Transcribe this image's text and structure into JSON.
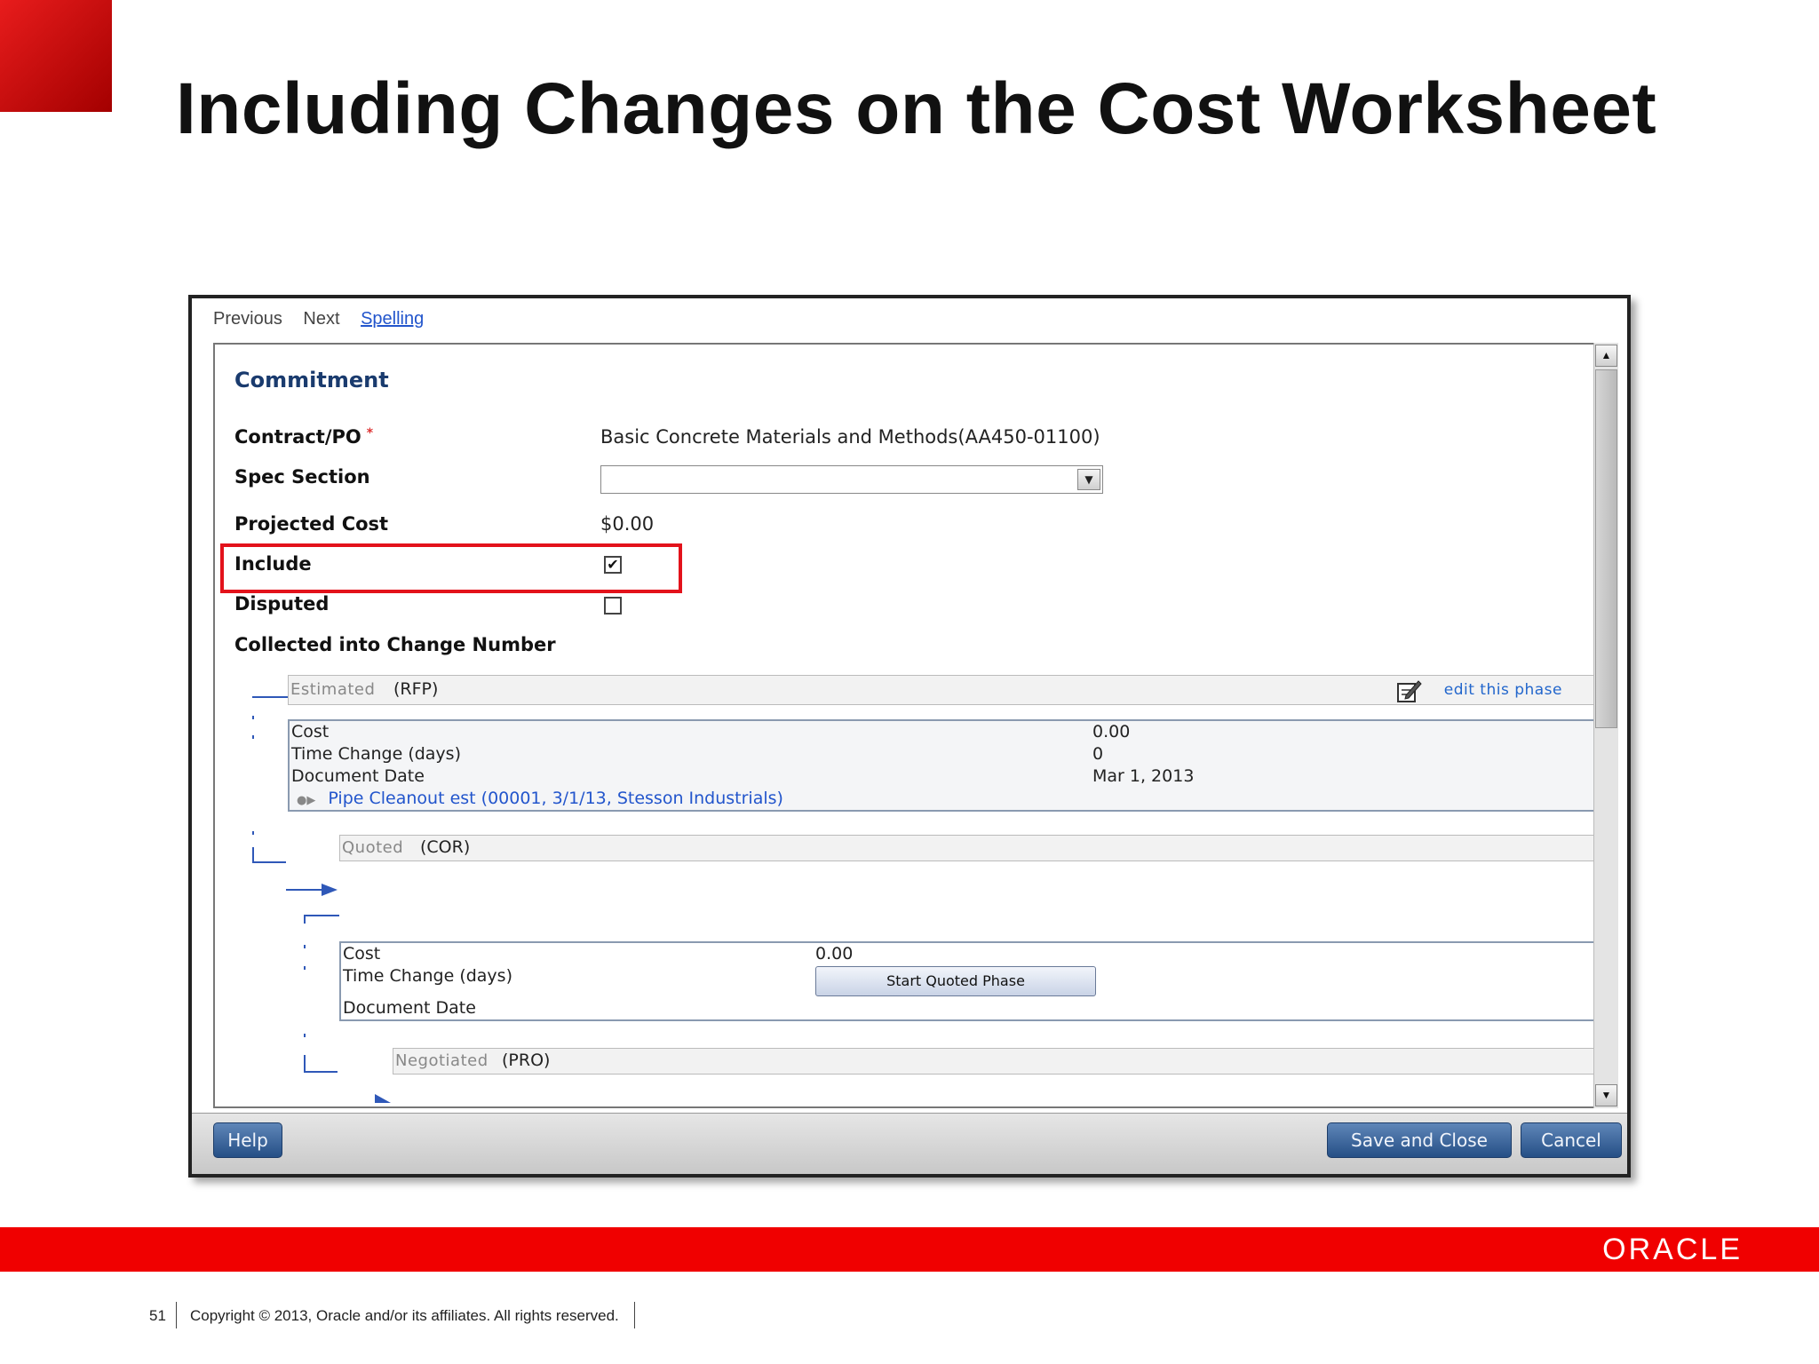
{
  "slide": {
    "title": "Including Changes on the Cost Worksheet",
    "page_number": "51",
    "copyright": "Copyright © 2013, Oracle and/or its affiliates. All rights reserved.",
    "logo_text": "ORACLE"
  },
  "nav": {
    "previous": "Previous",
    "next": "Next",
    "spelling": "Spelling"
  },
  "form": {
    "section_title": "Commitment",
    "contract_label": "Contract/PO",
    "required_mark": "*",
    "contract_value": "Basic Concrete Materials and Methods(AA450-01100)",
    "spec_section_label": "Spec Section",
    "spec_section_value": "",
    "projected_cost_label": "Projected Cost",
    "projected_cost_value": "$0.00",
    "include_label": "Include",
    "include_checked": true,
    "disputed_label": "Disputed",
    "disputed_checked": false,
    "collected_label": "Collected into Change Number"
  },
  "phases": {
    "estimated": {
      "name": "Estimated",
      "code": "(RFP)",
      "edit_link": "edit this phase",
      "cost_label": "Cost",
      "cost_value": "0.00",
      "time_label": "Time Change (days)",
      "time_value": "0",
      "date_label": "Document Date",
      "date_value": "Mar 1, 2013",
      "item_link": "Pipe Cleanout est (00001, 3/1/13, Stesson Industrials)"
    },
    "quoted": {
      "name": "Quoted",
      "code": "(COR)",
      "cost_label": "Cost",
      "cost_value": "0.00",
      "time_label": "Time Change (days)",
      "date_label": "Document Date",
      "start_button": "Start Quoted Phase"
    },
    "negotiated": {
      "name": "Negotiated",
      "code": "(PRO)"
    }
  },
  "buttons": {
    "help": "Help",
    "save_close": "Save and Close",
    "cancel": "Cancel"
  },
  "colors": {
    "accent_red": "#f00000",
    "link_blue": "#2255cc",
    "button_blue": "#254f86"
  },
  "icons": [
    "edit-icon",
    "dropdown-arrow-icon",
    "scroll-up-icon",
    "scroll-down-icon",
    "expand-icon",
    "arrow-right-icon"
  ]
}
